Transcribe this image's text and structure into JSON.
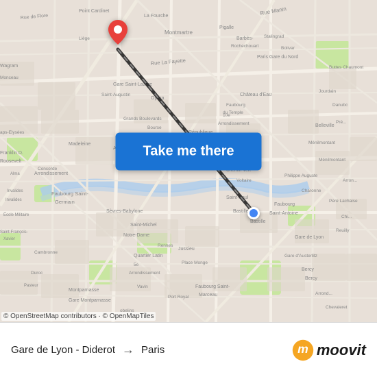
{
  "map": {
    "attribution": "© OpenStreetMap contributors · © OpenMapTiles",
    "route_line_color": "#1a1a1a",
    "origin_color": "#4285F4",
    "destination_color": "#e8403b"
  },
  "button": {
    "label": "Take me there"
  },
  "footer": {
    "origin": "Gare de Lyon - Diderot",
    "destination": "Paris",
    "arrow": "→"
  },
  "branding": {
    "name": "moovit"
  }
}
